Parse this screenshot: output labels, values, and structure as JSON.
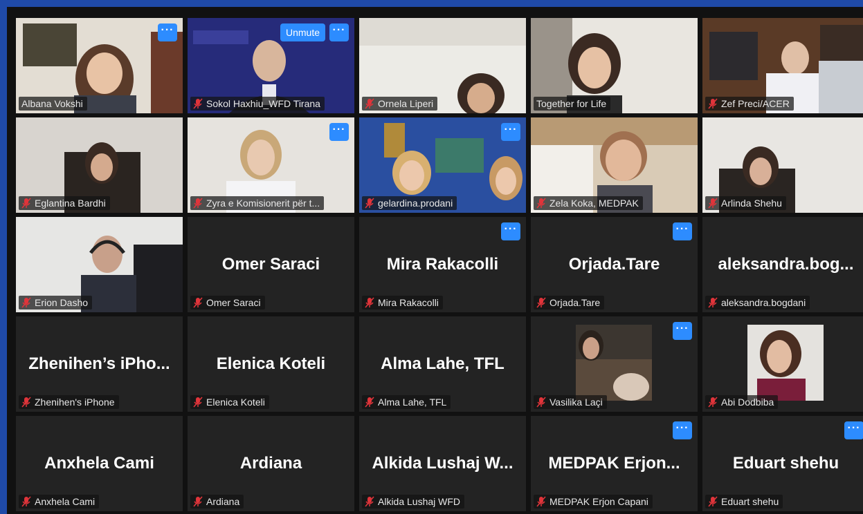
{
  "meeting": {
    "unmute_label": "Unmute",
    "more_glyph": "···",
    "participants": [
      {
        "name": "Albana Vokshi",
        "display": "",
        "video": true,
        "active": true
      },
      {
        "name": "Sokol Haxhiu_WFD Tirana",
        "display": "",
        "video": true
      },
      {
        "name": "Ornela Liperi",
        "display": "",
        "video": true
      },
      {
        "name": "Together for Life",
        "display": "",
        "video": true
      },
      {
        "name": "Zef Preci/ACER",
        "display": "",
        "video": true
      },
      {
        "name": "Eglantina Bardhi",
        "display": "",
        "video": true
      },
      {
        "name": "Zyra e Komisionerit për t...",
        "display": "",
        "video": true
      },
      {
        "name": "gelardina.prodani",
        "display": "",
        "video": true
      },
      {
        "name": "Zela Koka, MEDPAK",
        "display": "",
        "video": true
      },
      {
        "name": "Arlinda Shehu",
        "display": "",
        "video": true
      },
      {
        "name": "Erion Dasho",
        "display": "",
        "video": true
      },
      {
        "name": "Omer Saraci",
        "display": "Omer Saraci",
        "video": false
      },
      {
        "name": "Mira Rakacolli",
        "display": "Mira Rakacolli",
        "video": false
      },
      {
        "name": "Orjada.Tare",
        "display": "Orjada.Tare",
        "video": false
      },
      {
        "name": "aleksandra.bogdani",
        "display": "aleksandra.bog...",
        "video": false
      },
      {
        "name": "Zhenihen's iPhone",
        "display": "Zhenihen’s iPho...",
        "video": false
      },
      {
        "name": "Elenica Koteli",
        "display": "Elenica Koteli",
        "video": false
      },
      {
        "name": "Alma Lahe, TFL",
        "display": "Alma Lahe, TFL",
        "video": false
      },
      {
        "name": "Vasilika Laçi",
        "display": "",
        "video": false,
        "photo": true
      },
      {
        "name": "Abi Dodbiba",
        "display": "",
        "video": false,
        "photo": true
      },
      {
        "name": "Anxhela Cami",
        "display": "Anxhela Cami",
        "video": false
      },
      {
        "name": "Ardiana",
        "display": "Ardiana",
        "video": false
      },
      {
        "name": "Alkida Lushaj WFD",
        "display": "Alkida Lushaj W...",
        "video": false
      },
      {
        "name": "MEDPAK Erjon Capani",
        "display": "MEDPAK Erjon...",
        "video": false
      },
      {
        "name": "Eduart shehu",
        "display": "Eduart shehu",
        "video": false
      }
    ]
  },
  "colors": {
    "border_blue": "#1f4aa8",
    "active_speaker": "#d9e33a",
    "button_blue": "#2d8cff",
    "muted_red": "#e0343a"
  }
}
